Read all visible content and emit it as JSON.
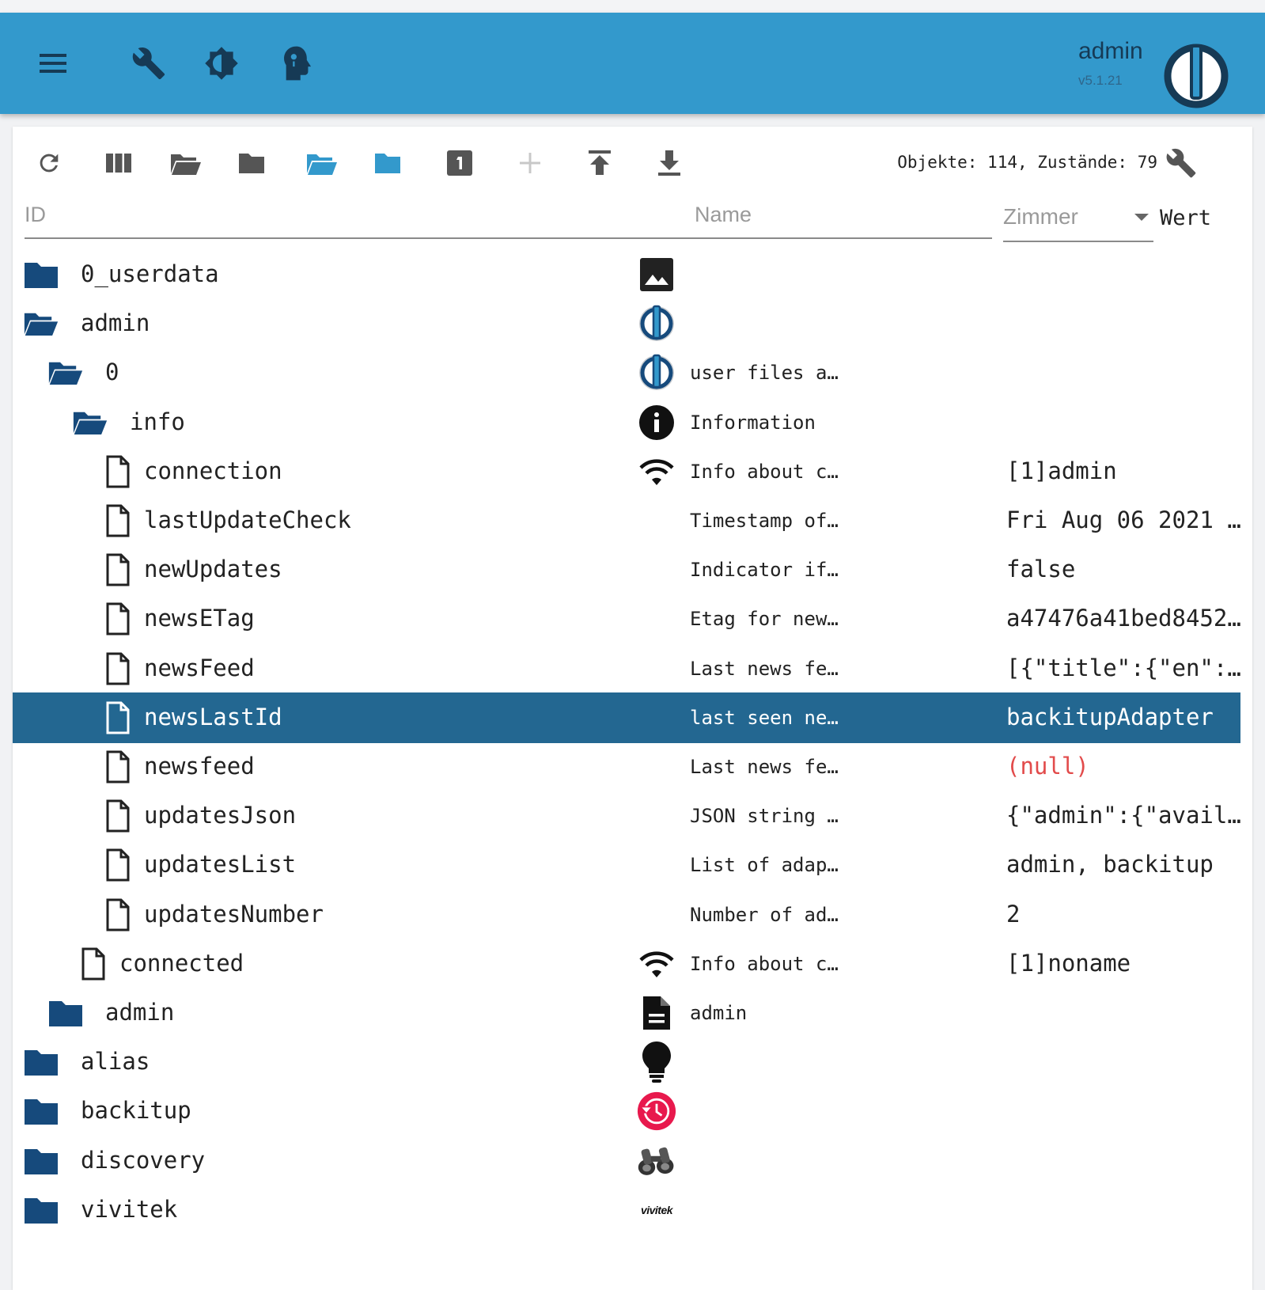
{
  "header": {
    "user": "admin",
    "version": "v5.1.21",
    "icons": [
      "menu-icon",
      "wrench-icon",
      "brightness-icon",
      "expert-head-icon"
    ]
  },
  "toolbar": {
    "counts": "Objekte: 114, Zustände: 79",
    "buttons": [
      "refresh-icon",
      "columns-icon",
      "folder-open-icon",
      "folder-icon",
      "folder-open-blue-icon",
      "folder-blue-icon",
      "number-one-icon",
      "plus-icon",
      "upload-icon",
      "download-icon"
    ]
  },
  "filters": {
    "id_placeholder": "ID",
    "name_placeholder": "Name",
    "room_label": "Zimmer",
    "value_header": "Wert"
  },
  "colors": {
    "appbar": "#3399cc",
    "selected_row": "#236791",
    "folder": "#164a7c",
    "null_value": "#e24b4b"
  },
  "rows": [
    {
      "id": "0_userdata",
      "level": 0,
      "kind": "folder",
      "icon": "image-icon",
      "name": "",
      "value": ""
    },
    {
      "id": "admin",
      "level": 0,
      "kind": "folder-open",
      "icon": "iobroker-logo-icon",
      "name": "",
      "value": ""
    },
    {
      "id": "0",
      "level": 1,
      "kind": "folder-open",
      "icon": "iobroker-logo-icon",
      "name": "user files a…",
      "value": ""
    },
    {
      "id": "info",
      "level": 2,
      "kind": "folder-open",
      "icon": "info-icon",
      "name": "Information",
      "value": ""
    },
    {
      "id": "connection",
      "level": 3,
      "kind": "file",
      "icon": "wifi-icon",
      "name": "Info about c…",
      "value": "[1]admin"
    },
    {
      "id": "lastUpdateCheck",
      "level": 3,
      "kind": "file",
      "icon": "",
      "name": "Timestamp of…",
      "value": "Fri Aug 06 2021 …"
    },
    {
      "id": "newUpdates",
      "level": 3,
      "kind": "file",
      "icon": "",
      "name": "Indicator if…",
      "value": "false"
    },
    {
      "id": "newsETag",
      "level": 3,
      "kind": "file",
      "icon": "",
      "name": "Etag for new…",
      "value": "a47476a41bed8452…"
    },
    {
      "id": "newsFeed",
      "level": 3,
      "kind": "file",
      "icon": "",
      "name": "Last news fe…",
      "value": "[{\"title\":{\"en\":…"
    },
    {
      "id": "newsLastId",
      "level": 3,
      "kind": "file",
      "icon": "",
      "name": "last seen ne…",
      "value": "backitupAdapter",
      "selected": true
    },
    {
      "id": "newsfeed",
      "level": 3,
      "kind": "file",
      "icon": "",
      "name": "Last news fe…",
      "value": "(null)",
      "null": true
    },
    {
      "id": "updatesJson",
      "level": 3,
      "kind": "file",
      "icon": "",
      "name": "JSON string …",
      "value": "{\"admin\":{\"avail…"
    },
    {
      "id": "updatesList",
      "level": 3,
      "kind": "file",
      "icon": "",
      "name": "List of adap…",
      "value": "admin, backitup"
    },
    {
      "id": "updatesNumber",
      "level": 3,
      "kind": "file",
      "icon": "",
      "name": "Number of ad…",
      "value": "2"
    },
    {
      "id": "connected",
      "level": 2,
      "kind": "file",
      "icon": "wifi-icon",
      "name": "Info about c…",
      "value": "[1]noname"
    },
    {
      "id": "admin",
      "level": 1,
      "kind": "folder",
      "icon": "document-icon",
      "name": "admin",
      "value": ""
    },
    {
      "id": "alias",
      "level": 0,
      "kind": "folder",
      "icon": "lightbulb-icon",
      "name": "",
      "value": ""
    },
    {
      "id": "backitup",
      "level": 0,
      "kind": "folder",
      "icon": "backup-clock-icon",
      "name": "",
      "value": ""
    },
    {
      "id": "discovery",
      "level": 0,
      "kind": "folder",
      "icon": "binoculars-icon",
      "name": "",
      "value": ""
    },
    {
      "id": "vivitek",
      "level": 0,
      "kind": "folder",
      "icon": "vivitek-logo-icon",
      "name": "",
      "value": "",
      "logo_text": "vivitek"
    }
  ]
}
